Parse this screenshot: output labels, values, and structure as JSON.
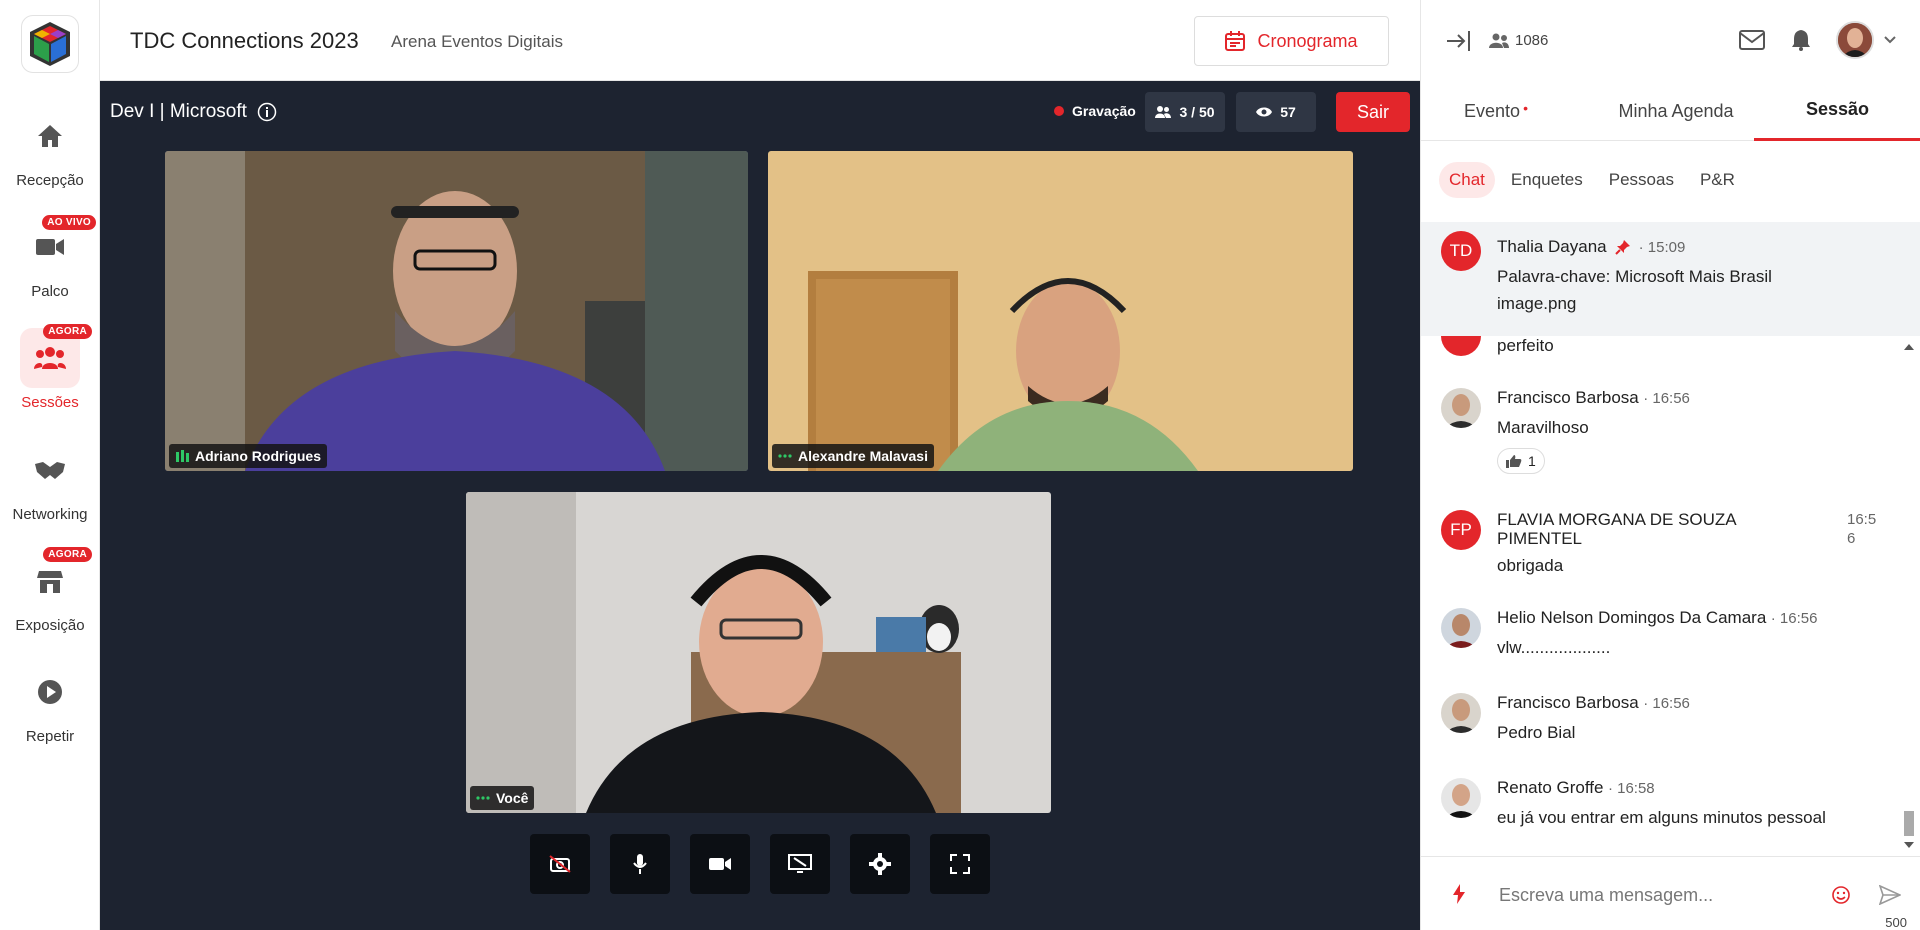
{
  "nav": {
    "items": [
      {
        "label": "Recepção",
        "icon": "home-icon"
      },
      {
        "label": "Palco",
        "icon": "camera-icon",
        "badge": "AO VIVO"
      },
      {
        "label": "Sessões",
        "icon": "people-icon",
        "badge": "AGORA",
        "active": true
      },
      {
        "label": "Networking",
        "icon": "handshake-icon"
      },
      {
        "label": "Exposição",
        "icon": "store-icon",
        "badge": "AGORA"
      },
      {
        "label": "Repetir",
        "icon": "play-icon"
      }
    ]
  },
  "header": {
    "title": "TDC Connections 2023",
    "subtitle": "Arena Eventos Digitais",
    "schedule_button": "Cronograma"
  },
  "stage": {
    "session_name": "Dev I | Microsoft",
    "recording_label": "Gravação",
    "participants": "3 / 50",
    "viewers": "57",
    "leave_button": "Sair",
    "tiles": [
      {
        "name": "Adriano Rodrigues",
        "speaking": true
      },
      {
        "name": "Alexandre Malavasi",
        "speaking": false
      },
      {
        "name": "Você",
        "speaking": false
      }
    ],
    "controls": [
      "camera-off-icon",
      "microphone-icon",
      "video-icon",
      "screen-share-icon",
      "gear-icon",
      "fullscreen-icon"
    ]
  },
  "topright": {
    "online_count": "1086"
  },
  "tabs": {
    "main": [
      "Evento",
      "Minha Agenda",
      "Sessão"
    ],
    "sub": [
      "Chat",
      "Enquetes",
      "Pessoas",
      "P&R"
    ]
  },
  "pinned": {
    "initials": "TD",
    "author": "Thalia Dayana",
    "time": "· 15:09",
    "text": "Palavra-chave: Microsoft Mais Brasil",
    "image_alt": "image.png"
  },
  "messages": [
    {
      "author": "",
      "time": "",
      "text": "perfeito"
    },
    {
      "author": "Francisco Barbosa",
      "time": "· 16:56",
      "text": "Maravilhoso",
      "reaction": "1"
    },
    {
      "author": "FLAVIA MORGANA DE SOUZA PIMENTEL",
      "initials": "FP",
      "time_a": "16:5",
      "time_b": "6",
      "text": "obrigada"
    },
    {
      "author": "Helio Nelson Domingos Da Camara",
      "time": "· 16:56",
      "text": "vlw..................."
    },
    {
      "author": "Francisco Barbosa",
      "time": "· 16:56",
      "text": "Pedro Bial"
    },
    {
      "author": "Renato Groffe",
      "time": "· 16:58",
      "text": "eu já vou entrar em alguns minutos pessoal"
    }
  ],
  "composer": {
    "placeholder": "Escreva uma mensagem...",
    "char_limit": "500"
  },
  "colors": {
    "accent": "#e3262b",
    "stage_bg": "#1d2330",
    "speaking_border": "#2c6bf0"
  }
}
